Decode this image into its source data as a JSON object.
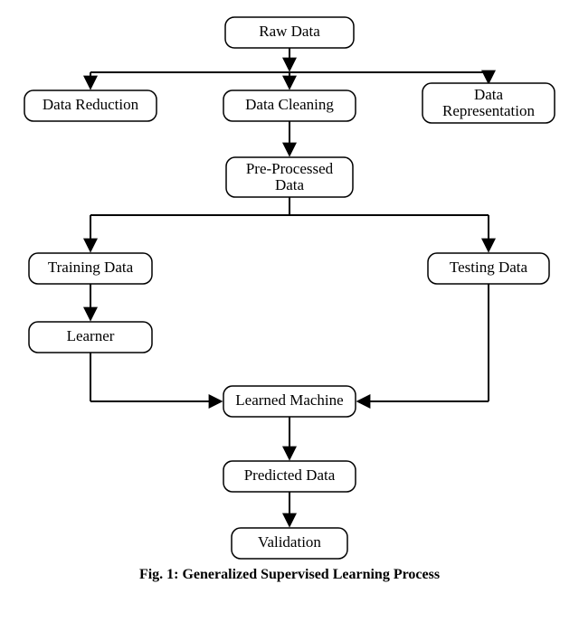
{
  "nodes": {
    "raw": {
      "label": "Raw Data"
    },
    "reduce": {
      "label": "Data Reduction"
    },
    "clean": {
      "label": "Data Cleaning"
    },
    "rep": {
      "label1": "Data",
      "label2": "Representation"
    },
    "pre": {
      "label1": "Pre-Processed",
      "label2": "Data"
    },
    "train": {
      "label": "Training Data"
    },
    "test": {
      "label": "Testing Data"
    },
    "learner": {
      "label": "Learner"
    },
    "lm": {
      "label": "Learned Machine"
    },
    "pred": {
      "label": "Predicted Data"
    },
    "valid": {
      "label": "Validation"
    }
  },
  "caption": "Fig. 1: Generalized Supervised Learning Process"
}
